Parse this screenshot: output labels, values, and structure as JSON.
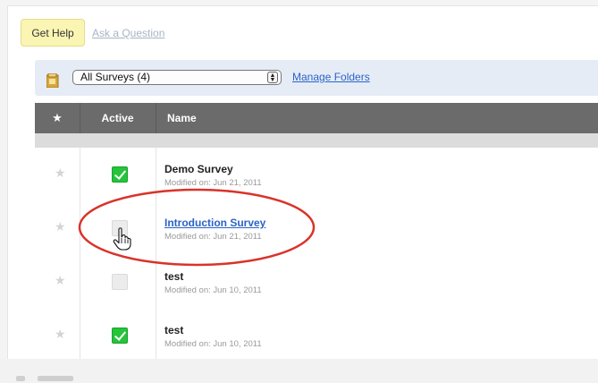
{
  "help": {
    "get_help_label": "Get Help",
    "ask_question_label": "Ask a Question"
  },
  "folder": {
    "selected": "All Surveys (4)",
    "manage_label": "Manage Folders"
  },
  "table": {
    "headers": {
      "star": "★",
      "active": "Active",
      "name": "Name"
    },
    "rows": [
      {
        "name": "Demo Survey",
        "modified": "Modified on: Jun 21, 2011",
        "active": true,
        "is_link": false
      },
      {
        "name": "Introduction Survey",
        "modified": "Modified on: Jun 21, 2011",
        "active": false,
        "is_link": true
      },
      {
        "name": "test",
        "modified": "Modified on: Jun 10, 2011",
        "active": false,
        "is_link": false
      },
      {
        "name": "test",
        "modified": "Modified on: Jun 10, 2011",
        "active": true,
        "is_link": false
      }
    ]
  },
  "icons": {
    "star": "star-icon",
    "folder": "folder-icon",
    "cursor": "hand-pointer-icon"
  },
  "colors": {
    "header_bg": "#6b6b6b",
    "folder_bar_bg": "#e6ecf6",
    "link": "#2b63c6",
    "check_green": "#24c43b",
    "highlight_red": "#d9332a",
    "help_bg": "#fbf5b3"
  }
}
